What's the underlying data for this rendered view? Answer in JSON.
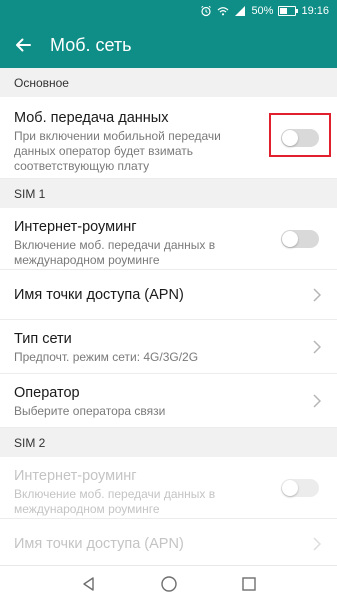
{
  "status": {
    "battery": "50%",
    "time": "19:16",
    "battery_level": 0.5
  },
  "appbar": {
    "title": "Моб. сеть"
  },
  "sections": {
    "main": {
      "header": "Основное",
      "mobile_data": {
        "title": "Моб. передача данных",
        "subtitle_lines": [
          "При включении мобильной передачи",
          "данных оператор будет взимать",
          "соответствующую плату"
        ],
        "switch_on": false
      }
    },
    "sim1": {
      "header": "SIM 1",
      "roaming": {
        "title": "Интернет-роуминг",
        "subtitle_lines": [
          "Включение моб. передачи данных в",
          "международном роуминге"
        ],
        "switch_on": false
      },
      "apn": {
        "title": "Имя точки доступа (APN)"
      },
      "network_type": {
        "title": "Тип сети",
        "subtitle": "Предпочт. режим сети: 4G/3G/2G"
      },
      "operator": {
        "title": "Оператор",
        "subtitle": "Выберите оператора связи"
      }
    },
    "sim2": {
      "header": "SIM 2",
      "roaming": {
        "title": "Интернет-роуминг",
        "subtitle_lines": [
          "Включение моб. передачи данных в",
          "международном роуминге"
        ],
        "switch_on": false,
        "disabled": true
      },
      "apn": {
        "title": "Имя точки доступа (APN)",
        "disabled": true
      }
    }
  },
  "colors": {
    "primary": "#0e8e86",
    "highlight": "#e0202c"
  },
  "icons": [
    "alarm-icon",
    "wifi-icon",
    "signal-icon",
    "battery-icon",
    "back-arrow-icon",
    "chevron-right-icon",
    "nav-back-icon",
    "nav-home-icon",
    "nav-recents-icon"
  ]
}
